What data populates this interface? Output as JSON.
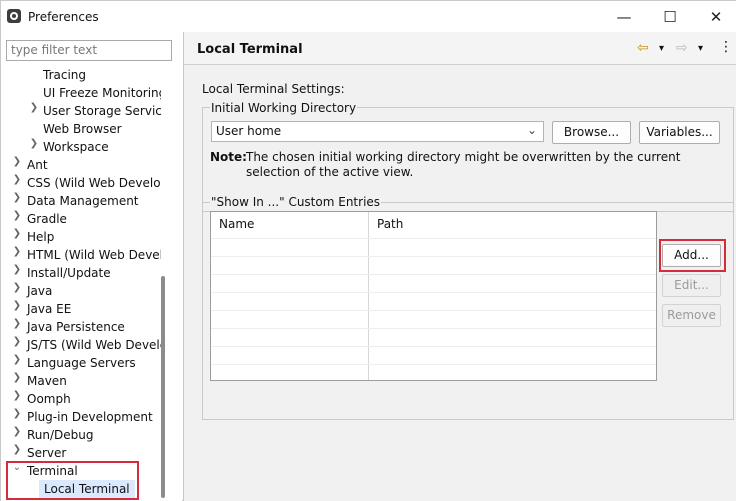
{
  "window": {
    "title": "Preferences",
    "minimize_icon": "minimize-icon",
    "maximize_icon": "maximize-icon",
    "close_icon": "close-icon"
  },
  "sidebar": {
    "filter_placeholder": "type filter text",
    "items": [
      {
        "label": "Tracing",
        "indent": 1,
        "arrow": ""
      },
      {
        "label": "UI Freeze Monitoring",
        "indent": 1,
        "arrow": ""
      },
      {
        "label": "User Storage Service",
        "indent": 1,
        "arrow": ">"
      },
      {
        "label": "Web Browser",
        "indent": 1,
        "arrow": ""
      },
      {
        "label": "Workspace",
        "indent": 1,
        "arrow": ">"
      },
      {
        "label": "Ant",
        "indent": 0,
        "arrow": ">"
      },
      {
        "label": "CSS (Wild Web Develop",
        "indent": 0,
        "arrow": ">"
      },
      {
        "label": "Data Management",
        "indent": 0,
        "arrow": ">"
      },
      {
        "label": "Gradle",
        "indent": 0,
        "arrow": ">"
      },
      {
        "label": "Help",
        "indent": 0,
        "arrow": ">"
      },
      {
        "label": "HTML (Wild Web Develo",
        "indent": 0,
        "arrow": ">"
      },
      {
        "label": "Install/Update",
        "indent": 0,
        "arrow": ">"
      },
      {
        "label": "Java",
        "indent": 0,
        "arrow": ">"
      },
      {
        "label": "Java EE",
        "indent": 0,
        "arrow": ">"
      },
      {
        "label": "Java Persistence",
        "indent": 0,
        "arrow": ">"
      },
      {
        "label": "JS/TS (Wild Web Develc",
        "indent": 0,
        "arrow": ">"
      },
      {
        "label": "Language Servers",
        "indent": 0,
        "arrow": ">"
      },
      {
        "label": "Maven",
        "indent": 0,
        "arrow": ">"
      },
      {
        "label": "Oomph",
        "indent": 0,
        "arrow": ">"
      },
      {
        "label": "Plug-in Development",
        "indent": 0,
        "arrow": ">"
      },
      {
        "label": "Run/Debug",
        "indent": 0,
        "arrow": ">"
      },
      {
        "label": "Server",
        "indent": 0,
        "arrow": ">"
      },
      {
        "label": "Terminal",
        "indent": 0,
        "arrow": "v"
      },
      {
        "label": "Local Terminal",
        "indent": 1,
        "arrow": ""
      }
    ]
  },
  "page": {
    "title": "Local Terminal",
    "settings_label": "Local Terminal Settings:",
    "initial_dir_group": "Initial Working Directory",
    "combo_value": "User home",
    "browse_button": "Browse...",
    "variables_button": "Variables...",
    "note_label": "Note:",
    "note_text": "The chosen initial working directory might be overwritten by the current selection of the active view.",
    "custom_entries_group": "\"Show In ...\" Custom Entries",
    "table_headers": [
      "Name",
      "Path"
    ],
    "add_button": "Add...",
    "edit_button": "Edit...",
    "remove_button": "Remove"
  },
  "colors": {
    "highlight": "#d42c3a"
  }
}
